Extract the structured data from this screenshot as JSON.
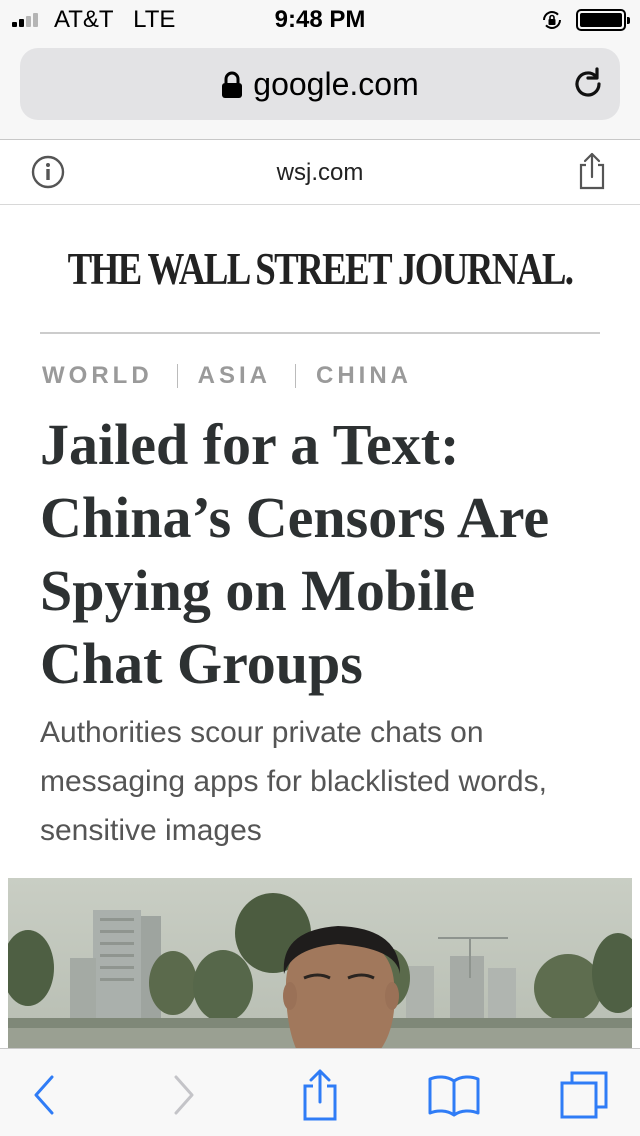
{
  "status_bar": {
    "carrier": "AT&T   LTE",
    "time": "9:48 PM",
    "signal_bars": 4,
    "signal_bars_active": 2,
    "battery_level": 1.0
  },
  "browser": {
    "url": "google.com",
    "site": "wsj.com"
  },
  "article": {
    "masthead": "THE WALL STREET JOURNAL.",
    "sections": [
      "WORLD",
      "ASIA",
      "CHINA"
    ],
    "headline": "Jailed for a Text: China’s Censors Are Spying on Mobile Chat Groups",
    "dek": "Authorities scour private chats on messaging apps for blacklisted words, sensitive images"
  },
  "icons": {
    "url_lock": "lock-icon",
    "reload": "reload-icon",
    "info": "info-icon",
    "share": "share-icon",
    "back": "back-arrow-icon",
    "forward": "forward-arrow-icon",
    "bookmarks": "bookmarks-icon",
    "tabs": "tabs-icon"
  },
  "colors": {
    "ios_blue": "#2f7cf6",
    "headline": "#2d3132",
    "section": "#9a9a9a"
  }
}
